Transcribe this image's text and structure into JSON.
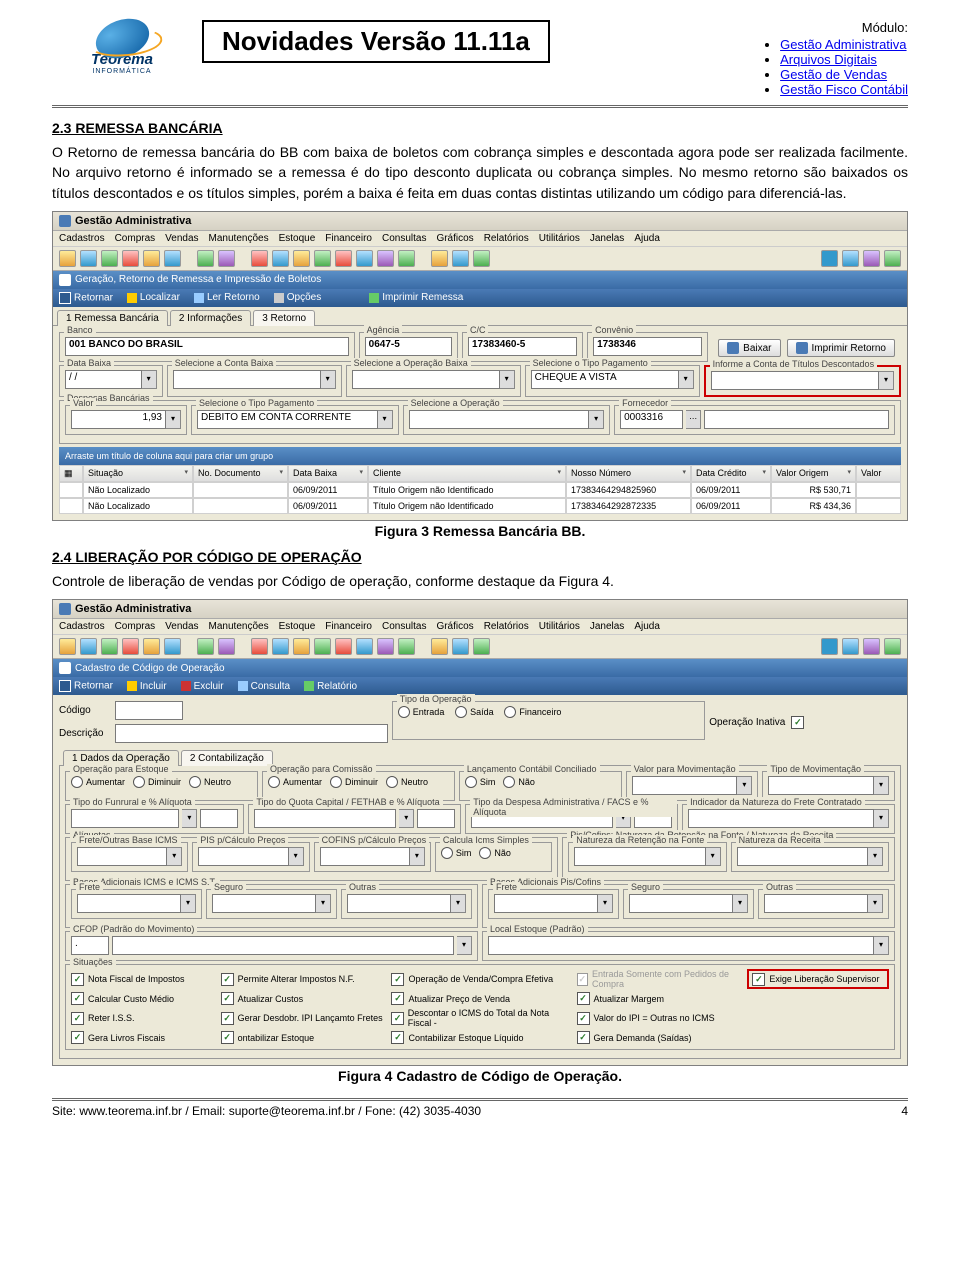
{
  "header": {
    "logo_name": "Teorema",
    "logo_sub": "INFORMÁTICA",
    "title": "Novidades Versão 11.11a",
    "module_label": "Módulo:",
    "modules": [
      "Gestão Administrativa",
      "Arquivos Digitais",
      "Gestão de Vendas",
      "Gestão Fisco Contábil"
    ]
  },
  "section23": {
    "heading": "2.3 REMESSA BANCÁRIA",
    "text": "O Retorno de remessa bancária do BB com baixa de boletos com cobrança simples e descontada agora pode ser realizada facilmente. No arquivo retorno é informado se a remessa é do tipo desconto duplicata ou cobrança simples. No mesmo retorno são baixados os títulos descontados e os títulos simples, porém a baixa é feita em duas contas distintas utilizando um código para diferenciá-las.",
    "caption": "Figura 3 Remessa Bancária BB."
  },
  "section24": {
    "heading": "2.4 LIBERAÇÃO POR CÓDIGO DE OPERAÇÃO",
    "text": "Controle de liberação de vendas por Código de operação, conforme destaque da Figura 4.",
    "caption": "Figura 4 Cadastro de Código de Operação."
  },
  "app_menu": [
    "Cadastros",
    "Compras",
    "Vendas",
    "Manutenções",
    "Estoque",
    "Financeiro",
    "Consultas",
    "Gráficos",
    "Relatórios",
    "Utilitários",
    "Janelas",
    "Ajuda"
  ],
  "shot1": {
    "title": "Gestão Administrativa",
    "panel_title": "Geração, Retorno de Remessa e Impressão de Boletos",
    "actions": {
      "retornar": "Retornar",
      "localizar": "Localizar",
      "ler": "Ler Retorno",
      "opcoes": "Opções",
      "imprimir": "Imprimir Remessa"
    },
    "tabs": [
      "1 Remessa Bancária",
      "2 Informações",
      "3 Retorno"
    ],
    "banco_label": "Banco",
    "banco": "001 BANCO DO BRASIL",
    "agencia_label": "Agência",
    "agencia": "0647-5",
    "cc_label": "C/C",
    "cc": "17383460-5",
    "convenio_label": "Convênio",
    "convenio": "1738346",
    "btn_baixar": "Baixar",
    "btn_imprimir_ret": "Imprimir Retorno",
    "data_baixa_label": "Data Baixa",
    "data_baixa": "/  /",
    "sel_conta_baixa": "Selecione a Conta Baixa",
    "sel_oper_baixa": "Selecione a Operação Baixa",
    "sel_tipo_pag": "Selecione o Tipo Pagamento",
    "tipo_pag": "CHEQUE A VISTA",
    "conta_desc": "Informe a Conta de Títulos Descontados",
    "desp_label": "Despesas Bancárias",
    "valor_label": "Valor",
    "valor": "1,93",
    "sel_tipo_pag2": "Selecione o Tipo Pagamento",
    "tipo_pag2": "DEBITO EM CONTA CORRENTE",
    "sel_oper": "Selecione a Operação",
    "fornecedor_label": "Fornecedor",
    "fornecedor": "0003316",
    "group_hint": "Arraste um título de coluna aqui para criar um grupo",
    "cols": {
      "situacao": "Situação",
      "nodoc": "No. Documento",
      "databaixa": "Data Baixa",
      "cliente": "Cliente",
      "nosso": "Nosso Número",
      "datacred": "Data Crédito",
      "valororig": "Valor Origem",
      "valor": "Valor"
    },
    "rows": [
      {
        "situacao": "Não Localizado",
        "databaixa": "06/09/2011",
        "cliente": "Título Origem não Identificado",
        "nosso": "17383464294825960",
        "datacred": "06/09/2011",
        "valor": "R$ 530,71"
      },
      {
        "situacao": "Não Localizado",
        "databaixa": "06/09/2011",
        "cliente": "Título Origem não Identificado",
        "nosso": "17383464292872335",
        "datacred": "06/09/2011",
        "valor": "R$ 434,36"
      }
    ]
  },
  "shot2": {
    "title": "Gestão Administrativa",
    "panel_title": "Cadastro de Código de Operação",
    "actions": {
      "retornar": "Retornar",
      "incluir": "Incluir",
      "excluir": "Excluir",
      "consulta": "Consulta",
      "relatorio": "Relatório"
    },
    "codigo_label": "Código",
    "descricao_label": "Descrição",
    "tipo_op_label": "Tipo da Operação",
    "tipo_ops": [
      "Entrada",
      "Saída",
      "Financeiro"
    ],
    "op_inativa": "Operação Inativa",
    "tabs": [
      "1 Dados da Operação",
      "2 Contabilização"
    ],
    "grp_estoque": "Operação para Estoque",
    "estoque_ops": [
      "Aumentar",
      "Diminuir",
      "Neutro"
    ],
    "grp_comissao": "Operação para Comissão",
    "comissao_ops": [
      "Aumentar",
      "Diminuir",
      "Neutro"
    ],
    "grp_lanc": "Lançamento Contábil Conciliado",
    "simnao": [
      "Sim",
      "Não"
    ],
    "grp_valor": "Valor para Movimentação",
    "grp_tipomov": "Tipo de Movimentação",
    "grp_funrural": "Tipo do Funrural e % Alíquota",
    "grp_quota": "Tipo do Quota Capital / FETHAB e % Alíquota",
    "grp_despesa": "Tipo da Despesa Administrativa / FACS e % Alíquota",
    "grp_indicador": "Indicador da Natureza do Frete Contratado",
    "grp_aliquotas": "Alíquotas",
    "ali_frete": "Frete/Outras Base ICMS",
    "ali_pis": "PIS p/Cálculo Preços",
    "ali_cofins": "COFINS p/Cálculo Preços",
    "ali_calc": "Calcula Icms Simples",
    "grp_piscofins": "Pis/Cofins: Natureza da Retenção na Fonte / Natureza da Receita",
    "nat_fonte": "Natureza da Retenção na Fonte",
    "nat_receita": "Natureza da Receita",
    "grp_bases": "Bases Adicionais ICMS e ICMS S.T.",
    "b_frete": "Frete",
    "b_seguro": "Seguro",
    "b_outras": "Outras",
    "grp_bases_pc": "Bases Adicionais Pis/Cofins",
    "grp_cfop": "CFOP (Padrão do Movimento)",
    "grp_localest": "Local Estoque (Padrão)",
    "grp_sit": "Situações",
    "checks": {
      "c1": "Nota Fiscal de Impostos",
      "c2": "Permite Alterar Impostos N.F.",
      "c3": "Operação de Venda/Compra Efetiva",
      "c4": "Entrada Somente com Pedidos de Compra",
      "c5": "Exige Liberação Supervisor",
      "c6": "Calcular Custo Médio",
      "c7": "Atualizar Custos",
      "c8": "Atualizar Preço de Venda",
      "c9": "Atualizar Margem",
      "c10": "Reter I.S.S.",
      "c11": "Gerar Desdobr. IPI Lançamto Fretes",
      "c12": "Descontar o ICMS do Total da Nota Fiscal -",
      "c13": "Valor do IPI = Outras no ICMS",
      "c14": "Gera Livros Fiscais",
      "c15": "ontabilizar Estoque",
      "c16": "Contabilizar Estoque Líquido",
      "c17": "Gera Demanda (Saídas)"
    }
  },
  "footer": {
    "site": "Site: www.teorema.inf.br / Email: suporte@teorema.inf.br / Fone: (42) 3035-4030",
    "page": "4"
  }
}
